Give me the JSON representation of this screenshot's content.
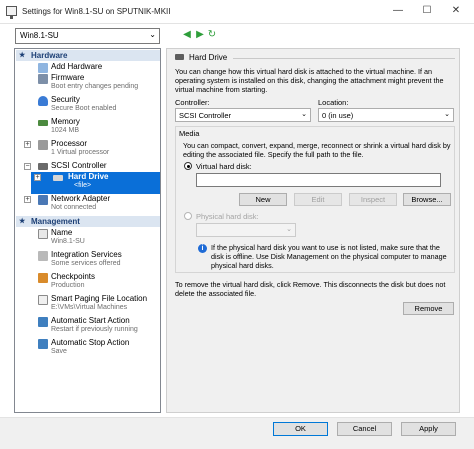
{
  "window": {
    "title": "Settings for Win8.1-SU on SPUTNIK-MKII",
    "minimize": "—",
    "maximize": "☐",
    "close": "✕"
  },
  "toolbar": {
    "vm_selected": "Win8.1-SU"
  },
  "tree": {
    "hardware_header": "Hardware",
    "management_header": "Management",
    "hardware_items": [
      {
        "label": "Add Hardware",
        "sub": ""
      },
      {
        "label": "Firmware",
        "sub": "Boot entry changes pending"
      },
      {
        "label": "Security",
        "sub": "Secure Boot enabled"
      },
      {
        "label": "Memory",
        "sub": "1024 MB"
      },
      {
        "label": "Processor",
        "sub": "1 Virtual processor"
      },
      {
        "label": "SCSI Controller",
        "sub": ""
      },
      {
        "label": "Hard Drive",
        "sub": "<file>"
      },
      {
        "label": "Network Adapter",
        "sub": "Not connected"
      }
    ],
    "management_items": [
      {
        "label": "Name",
        "sub": "Win8.1-SU"
      },
      {
        "label": "Integration Services",
        "sub": "Some services offered"
      },
      {
        "label": "Checkpoints",
        "sub": "Production"
      },
      {
        "label": "Smart Paging File Location",
        "sub": "E:\\VMs\\Virtual Machines"
      },
      {
        "label": "Automatic Start Action",
        "sub": "Restart if previously running"
      },
      {
        "label": "Automatic Stop Action",
        "sub": "Save"
      }
    ]
  },
  "panel": {
    "header": "Hard Drive",
    "description": "You can change how this virtual hard disk is attached to the virtual machine. If an operating system is installed on this disk, changing the attachment might prevent the virtual machine from starting.",
    "controller_label": "Controller:",
    "controller_value": "SCSI Controller",
    "location_label": "Location:",
    "location_value": "0 (in use)",
    "media_label": "Media",
    "media_description": "You can compact, convert, expand, merge, reconnect or shrink a virtual hard disk by editing the associated file. Specify the full path to the file.",
    "vhd_label": "Virtual hard disk:",
    "vhd_value": "",
    "new_button": "New",
    "edit_button": "Edit",
    "inspect_button": "Inspect",
    "browse_button": "Browse...",
    "physical_label": "Physical hard disk:",
    "physical_value": "",
    "physical_note": "If the physical hard disk you want to use is not listed, make sure that the disk is offline. Use Disk Management on the physical computer to manage physical hard disks.",
    "remove_description": "To remove the virtual hard disk, click Remove. This disconnects the disk but does not delete the associated file.",
    "remove_button": "Remove"
  },
  "footer": {
    "ok": "OK",
    "cancel": "Cancel",
    "apply": "Apply"
  },
  "colors": {
    "selection": "#0a6fd8",
    "section_header_bg": "#dbe5f1",
    "section_header_text": "#1c3f75",
    "nav_arrow": "#2e9e3a"
  }
}
